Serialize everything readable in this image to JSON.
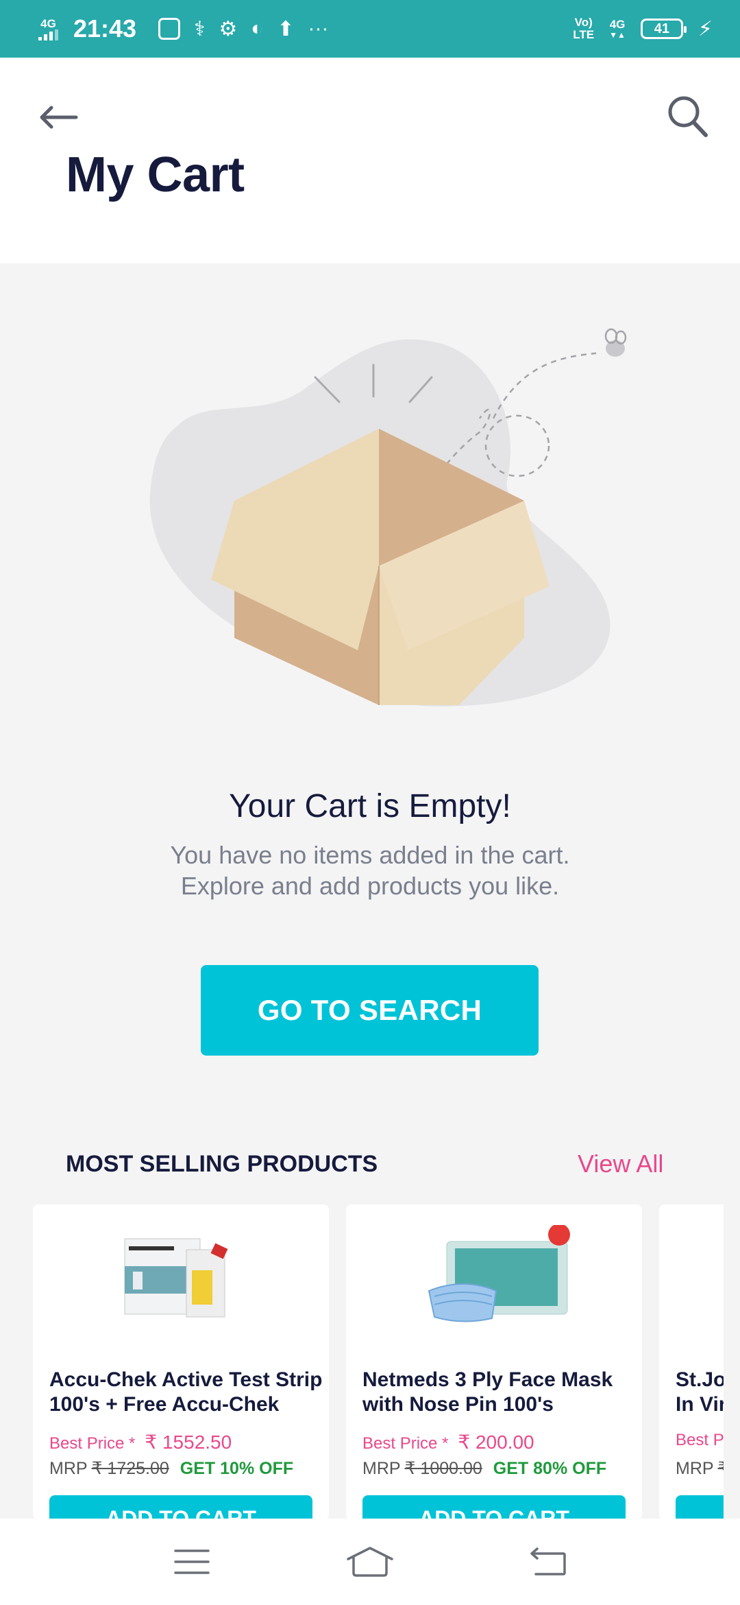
{
  "status_bar": {
    "network_left": "4G",
    "time": "21:43",
    "more": "···",
    "volte_top": "Vo)",
    "volte_bottom": "LTE",
    "network_right": "4G",
    "battery": "41"
  },
  "header": {
    "title": "My Cart"
  },
  "empty_state": {
    "title": "Your Cart is Empty!",
    "line1": "You have no items added in the cart.",
    "line2": "Explore and add products you like.",
    "button_label": "GO TO SEARCH"
  },
  "most_selling": {
    "heading": "MOST SELLING PRODUCTS",
    "view_all": "View All",
    "products": [
      {
        "name_line1": "Accu-Chek Active Test Strip",
        "name_line2": "100's + Free Accu-Chek",
        "best_label": "Best Price *",
        "best_price": "₹ 1552.50",
        "mrp_label": "MRP",
        "mrp_value": "₹ 1725.00",
        "offer": "GET  10% OFF",
        "button": "ADD TO CART"
      },
      {
        "name_line1": "Netmeds 3 Ply Face Mask",
        "name_line2": "with Nose Pin 100's",
        "best_label": "Best Price *",
        "best_price": "₹ 200.00",
        "mrp_label": "MRP",
        "mrp_value": "₹ 1000.00",
        "offer": "GET  80% OFF",
        "button": "ADD TO CART"
      },
      {
        "name_line1": "St.Joh",
        "name_line2": "In Vir",
        "best_label": "Best Pr",
        "best_price": "",
        "mrp_label": "MRP",
        "mrp_value": "₹",
        "offer": "",
        "button": ""
      }
    ]
  },
  "colors": {
    "status_bar": "#28a9aa",
    "accent": "#00c3d7",
    "pink": "#e8488a",
    "green": "#1f9a3c",
    "title": "#161b3d"
  },
  "icons": [
    "back-arrow-icon",
    "search-icon",
    "menu-icon",
    "home-icon",
    "back-nav-icon"
  ]
}
